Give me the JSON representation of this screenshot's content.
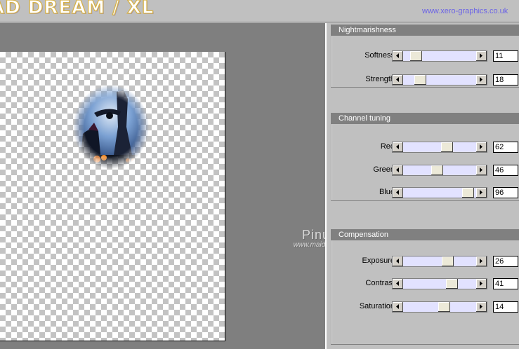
{
  "header": {
    "app_title": "AD DREAM / XL",
    "site_url": "www.xero-graphics.co.uk"
  },
  "watermark": {
    "name": "Pinuccia",
    "url": "www.maidiregrafica.eu"
  },
  "groups": [
    {
      "title": "Nightmarishness",
      "sliders": [
        {
          "label": "Softness",
          "value": "11",
          "level": 0.11
        },
        {
          "label": "Strength",
          "value": "18",
          "level": 0.18
        }
      ]
    },
    {
      "title": "Channel tuning",
      "sliders": [
        {
          "label": "Red",
          "value": "62",
          "level": 0.62
        },
        {
          "label": "Green",
          "value": "46",
          "level": 0.46
        },
        {
          "label": "Blue",
          "value": "96",
          "level": 0.96
        }
      ]
    },
    {
      "title": "Compensation",
      "sliders": [
        {
          "label": "Exposure",
          "value": "26",
          "level": 0.63
        },
        {
          "label": "Contrast",
          "value": "41",
          "level": 0.7
        },
        {
          "label": "Saturation",
          "value": "14",
          "level": 0.57
        }
      ]
    }
  ],
  "colors": {
    "slider_track": "#e2e2ff",
    "group_header": "#808080",
    "url_text": "#6b63e6"
  }
}
